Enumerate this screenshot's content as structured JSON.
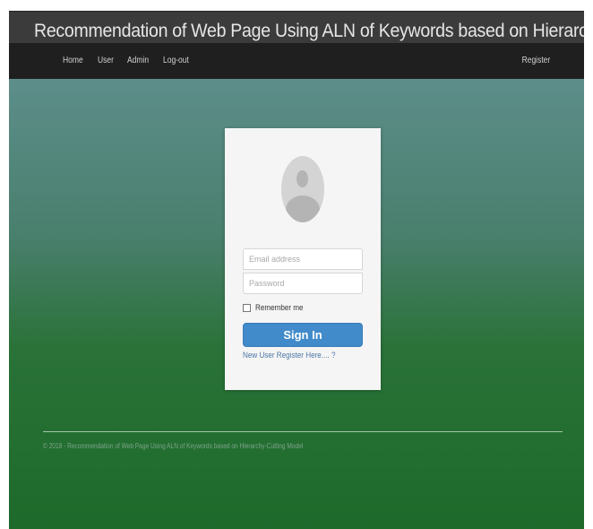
{
  "header": {
    "title": "Recommendation of Web Page Using ALN of Keywords based on Hierarchy-Cutting Model"
  },
  "nav": {
    "items": [
      {
        "label": "Home"
      },
      {
        "label": "User"
      },
      {
        "label": "Admin"
      },
      {
        "label": "Log-out"
      }
    ],
    "register_label": "Register"
  },
  "login": {
    "avatar_icon": "user-avatar-icon",
    "email_placeholder": "Email address",
    "email_value": "",
    "password_placeholder": "Password",
    "password_value": "",
    "remember_label": "Remember me",
    "remember_checked": false,
    "signin_label": "Sign In",
    "register_link": "New User Register Here.... ?",
    "accent_color": "#428bca"
  },
  "footer": {
    "text": "© 2018 - Recommendation of Web Page Using ALN of Keywords based on Hierarchy-Cutting Model"
  }
}
